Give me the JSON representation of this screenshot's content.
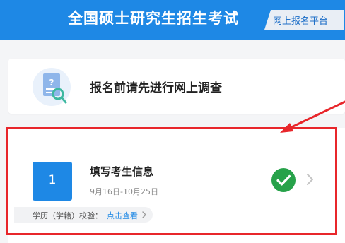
{
  "header": {
    "title": "全国硕士研究生招生考试",
    "tag": "网上报名平台",
    "background_color": "#1e88e5"
  },
  "survey_card": {
    "icon": "document-search-icon",
    "text": "报名前请先进行网上调查"
  },
  "step_card": {
    "step_number": "1",
    "title": "填写考生信息",
    "date_range": "9月16日-10月25日",
    "status_icon": "check-circle-icon",
    "status_color": "#27a24a",
    "highlight_color": "#e8262b"
  },
  "verify": {
    "label": "学历（学籍）校验：",
    "link_text": "点击查看"
  }
}
